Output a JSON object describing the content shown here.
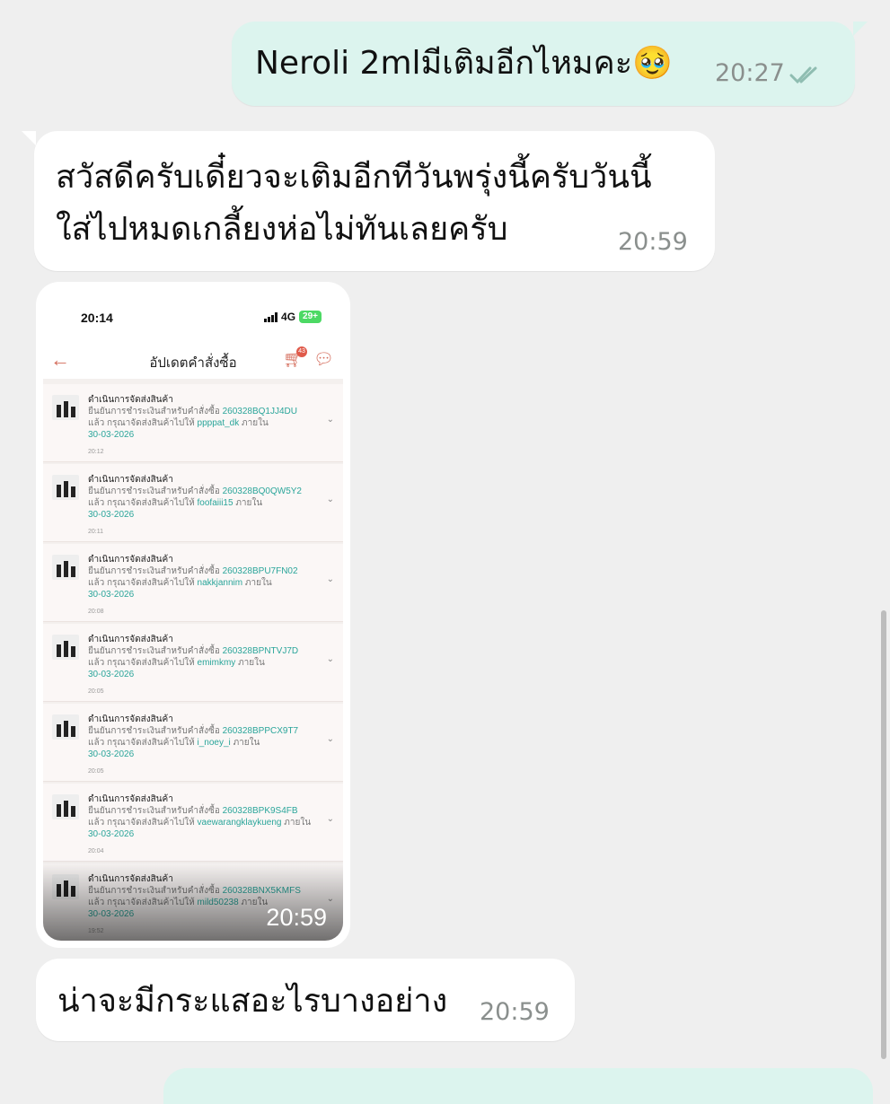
{
  "messages": [
    {
      "text": "Neroli 2mlมีเติมอีกไหมคะ🥹",
      "time": "20:27"
    },
    {
      "line1": "สวัสดีครับเดี๋ยวจะเติมอีกทีวันพรุ่งนี้ครับวันนี้",
      "line2": "ใส่ไปหมดเกลี้ยงห่อไม่ทันเลยครับ",
      "time": "20:59"
    },
    {
      "time": "20:59"
    },
    {
      "text": "น่าจะมีกระแสอะไรบางอย่าง",
      "time": "20:59"
    }
  ],
  "screenshot": {
    "status_time": "20:14",
    "network": "4G",
    "battery": "29+",
    "title": "อัปเดตคำสั่งซื้อ",
    "cart_badge": "43",
    "orders": [
      {
        "title": "ดำเนินการจัดส่งสินค้า",
        "prefix": "ยืนยันการชำระเงินสำหรับคำสั่งซื้อ",
        "order_id": "260328BQ1JJ4DU",
        "mid": "แล้ว กรุณาจัดส่งสินค้าไปให้",
        "user": "ppppat_dk",
        "suffix": "ภายใน",
        "date": "30-03-2026",
        "time": "20:12"
      },
      {
        "title": "ดำเนินการจัดส่งสินค้า",
        "prefix": "ยืนยันการชำระเงินสำหรับคำสั่งซื้อ",
        "order_id": "260328BQ0QW5Y2",
        "mid": "แล้ว กรุณาจัดส่งสินค้าไปให้",
        "user": "foofaiii15",
        "suffix": "ภายใน",
        "date": "30-03-2026",
        "time": "20:11"
      },
      {
        "title": "ดำเนินการจัดส่งสินค้า",
        "prefix": "ยืนยันการชำระเงินสำหรับคำสั่งซื้อ",
        "order_id": "260328BPU7FN02",
        "mid": "แล้ว กรุณาจัดส่งสินค้าไปให้",
        "user": "nakkjannim",
        "suffix": "ภายใน",
        "date": "30-03-2026",
        "time": "20:08"
      },
      {
        "title": "ดำเนินการจัดส่งสินค้า",
        "prefix": "ยืนยันการชำระเงินสำหรับคำสั่งซื้อ",
        "order_id": "260328BPNTVJ7D",
        "mid": "แล้ว กรุณาจัดส่งสินค้าไปให้",
        "user": "emimkmy",
        "suffix": "ภายใน",
        "date": "30-03-2026",
        "time": "20:05"
      },
      {
        "title": "ดำเนินการจัดส่งสินค้า",
        "prefix": "ยืนยันการชำระเงินสำหรับคำสั่งซื้อ",
        "order_id": "260328BPPCX9T7",
        "mid": "แล้ว กรุณาจัดส่งสินค้าไปให้",
        "user": "i_noey_i",
        "suffix": "ภายใน",
        "date": "30-03-2026",
        "time": "20:05"
      },
      {
        "title": "ดำเนินการจัดส่งสินค้า",
        "prefix": "ยืนยันการชำระเงินสำหรับคำสั่งซื้อ",
        "order_id": "260328BPK9S4FB",
        "mid": "แล้ว กรุณาจัดส่งสินค้าไปให้",
        "user": "vaewarangklaykueng",
        "suffix": "ภายใน",
        "date": "30-03-2026",
        "time": "20:04"
      },
      {
        "title": "ดำเนินการจัดส่งสินค้า",
        "prefix": "ยืนยันการชำระเงินสำหรับคำสั่งซื้อ",
        "order_id": "260328BNX5KMFS",
        "mid": "แล้ว กรุณาจัดส่งสินค้าไปให้",
        "user": "mild50238",
        "suffix": "ภายใน",
        "date": "30-03-2026",
        "time": "19:52"
      }
    ]
  },
  "colors": {
    "outgoing": "#dcf4ee",
    "incoming": "#ffffff",
    "background": "#efefef",
    "accent": "#2aa59a"
  }
}
